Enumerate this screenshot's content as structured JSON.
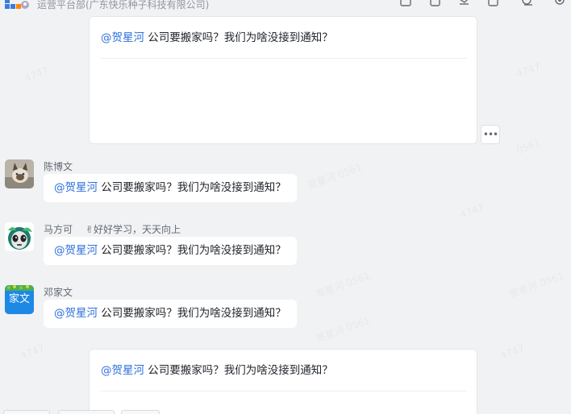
{
  "header": {
    "org_name": "运营平台部(广东快乐种子科技有限公司)"
  },
  "watermark": {
    "text_a": "贺星河 0561",
    "text_b": "0561",
    "text_c": "4747"
  },
  "quote_top": {
    "mention": "@贺星河",
    "text": " 公司要搬家吗？我们为啥没接到通知？"
  },
  "more_button": {
    "label": "•••"
  },
  "messages": [
    {
      "sender": "陈博文",
      "status": "",
      "mention": "@贺星河",
      "text": " 公司要搬家吗？我们为啥没接到通知？"
    },
    {
      "sender": "马方可",
      "status": "✌好好学习，天天向上",
      "mention": "@贺星河",
      "text": " 公司要搬家吗？我们为啥没接到通知？"
    },
    {
      "sender": "邓家文",
      "status": "",
      "avatar_text": "家文",
      "mention": "@贺星河",
      "text": " 公司要搬家吗？我们为啥没接到通知？"
    }
  ],
  "quote_bottom": {
    "mention": "@贺星河",
    "text": " 公司要搬家吗？我们为啥没接到通知？"
  },
  "colors": {
    "background": "#f1f2f4",
    "mention": "#2d6fdc",
    "sender": "#646a73",
    "avatar_blue": "#1e88e5"
  },
  "icons": {
    "org": "org-logo-icon",
    "toolbar": [
      "add-chat-icon",
      "pin-icon",
      "mute-icon",
      "note-icon",
      "search-icon",
      "settings-icon"
    ]
  }
}
